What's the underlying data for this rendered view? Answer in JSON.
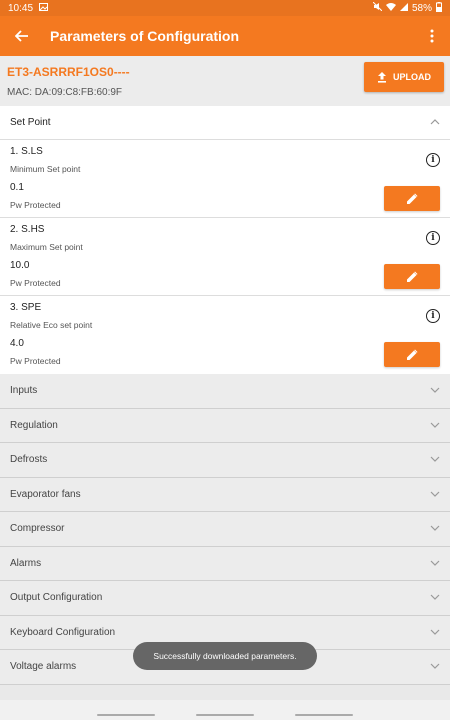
{
  "statusbar": {
    "time": "10:45",
    "battery": "58%"
  },
  "appbar": {
    "title": "Parameters of Configuration"
  },
  "device": {
    "name": "ET3-ASRRRF1OS0----",
    "mac": "MAC: DA:09:C8:FB:60:9F",
    "upload_label": "UPLOAD"
  },
  "set_point": {
    "label": "Set Point",
    "params": [
      {
        "name": "1. S.LS",
        "desc": "Minimum Set point",
        "value": "0.1",
        "protection": "Pw Protected"
      },
      {
        "name": "2. S.HS",
        "desc": "Maximum Set point",
        "value": "10.0",
        "protection": "Pw Protected"
      },
      {
        "name": "3. SPE",
        "desc": "Relative Eco set point",
        "value": "4.0",
        "protection": "Pw Protected"
      }
    ]
  },
  "sections": [
    "Inputs",
    "Regulation",
    "Defrosts",
    "Evaporator fans",
    "Compressor",
    "Alarms",
    "Output Configuration",
    "Keyboard Configuration",
    "Voltage alarms"
  ],
  "toast": "Successfully downloaded parameters.",
  "colors": {
    "accent": "#f47920",
    "toast_bg": "#666666"
  }
}
